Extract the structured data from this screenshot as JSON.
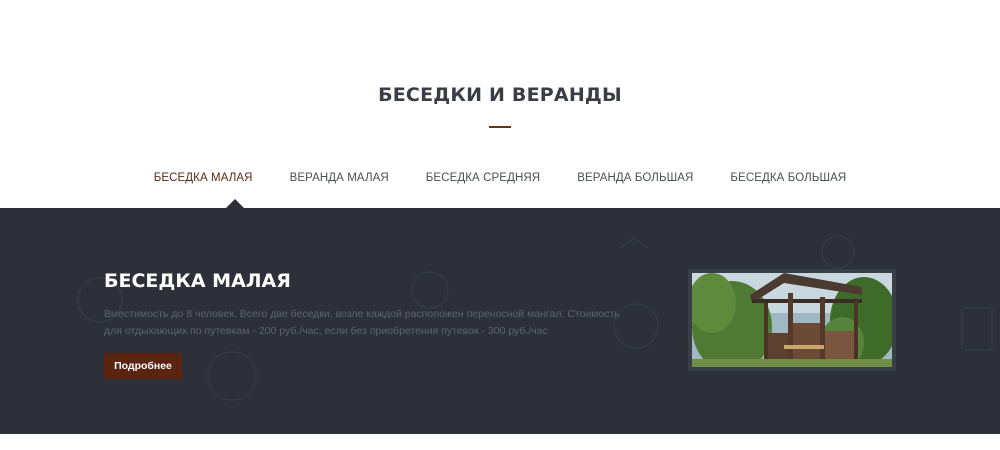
{
  "section": {
    "title": "БЕСЕДКИ И ВЕРАНДЫ"
  },
  "tabs": [
    {
      "label": "БЕСЕДКА МАЛАЯ",
      "active": true
    },
    {
      "label": "ВЕРАНДА МАЛАЯ",
      "active": false
    },
    {
      "label": "БЕСЕДКА СРЕДНЯЯ",
      "active": false
    },
    {
      "label": "ВЕРАНДА БОЛЬШАЯ",
      "active": false
    },
    {
      "label": "БЕСЕДКА БОЛЬШАЯ",
      "active": false
    }
  ],
  "item": {
    "title": "БЕСЕДКА МАЛАЯ",
    "description": "Вместимость до 8 человек. Всего две беседки, возле каждой расположен переносной мангал. Стоимость для отдыхающих по путевкам - 200 руб./час, если без приобретения путевок - 300 руб./час",
    "button_label": "Подробнее"
  },
  "colors": {
    "accent": "#5a2411",
    "panel_bg": "#2d3038",
    "title_text": "#3a3d44"
  }
}
